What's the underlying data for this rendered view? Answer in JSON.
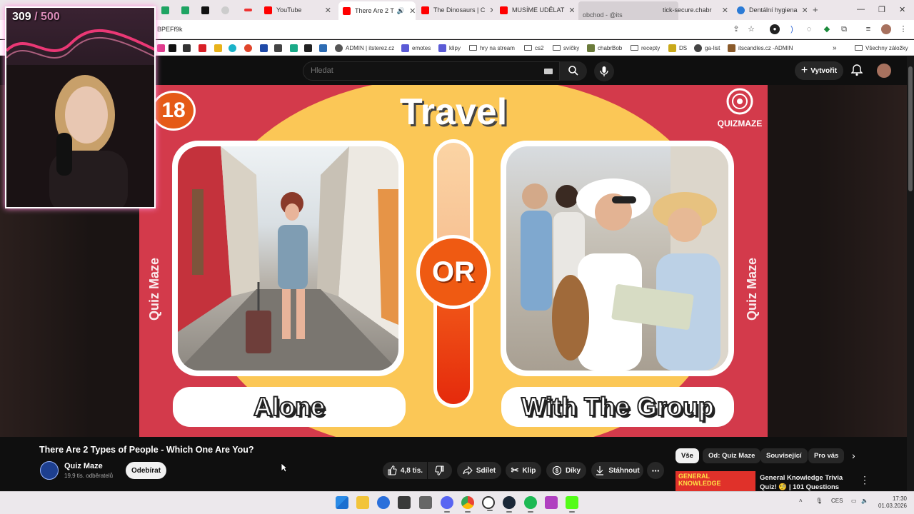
{
  "browser": {
    "tabs": [
      {
        "title": "YouTube",
        "favicon_color": "#ff0000"
      },
      {
        "title": "There Are 2 T",
        "favicon_color": "#ff0000",
        "active": true
      },
      {
        "title": "The Dinosaurs | C",
        "favicon_color": "#ff0000"
      },
      {
        "title": "MUSÍME UDĚLAT",
        "favicon_color": "#ff0000"
      },
      {
        "title": "obchod - @its",
        "favicon_color": "#888888"
      },
      {
        "title": "tick-secure.chabr",
        "favicon_color": "#555555"
      },
      {
        "title": "Dentální hygiena",
        "favicon_color": "#2b7bd6"
      }
    ],
    "url": "BPEFf9k",
    "bookmarks": [
      {
        "label": "ADMIN | itsterez.cz",
        "color": "#555555"
      },
      {
        "label": "emotes",
        "color": "#5b5bd6"
      },
      {
        "label": "klipy",
        "color": "#5b5bd6"
      },
      {
        "label": "hry na stream",
        "folder": true
      },
      {
        "label": "cs2",
        "folder": true
      },
      {
        "label": "svíčky",
        "folder": true
      },
      {
        "label": "chabrBob",
        "color": "#6b7b3b"
      },
      {
        "label": "recepty",
        "folder": true
      },
      {
        "label": "DS",
        "color": "#c9a91a"
      },
      {
        "label": "ga-list",
        "color": "#444444"
      },
      {
        "label": "itscandles.cz -ADMIN",
        "color": "#8a5a2a"
      }
    ],
    "all_bookmarks": "Všechny záložky"
  },
  "youtube": {
    "search_placeholder": "Hledat",
    "create_label": "Vytvořit"
  },
  "overlay": {
    "count": "309",
    "separator": " / ",
    "goal": "500"
  },
  "thumbnail": {
    "number": "18",
    "title": "Travel",
    "logo_text": "QUIZMAZE",
    "side_text": "Quiz Maze",
    "or_label": "OR",
    "option_left": "Alone",
    "option_right": "With The Group"
  },
  "video": {
    "title": "There Are 2 Types of People - Which One Are You?",
    "channel": "Quiz Maze",
    "subscribers": "19,9 tis. odběratelů",
    "subscribe_label": "Odebírat",
    "likes": "4,8 tis.",
    "share_label": "Sdílet",
    "clip_label": "Klip",
    "thanks_label": "Díky",
    "download_label": "Stáhnout"
  },
  "filter_chips": [
    "Vše",
    "Od: Quiz Maze",
    "Související",
    "Pro vás"
  ],
  "recommendation": {
    "thumb_text": "GENERAL KNOWLEDGE",
    "title": "General Knowledge Trivia Quiz! 🧐 | 101 Questions EVERYON..."
  },
  "taskbar": {
    "language": "CES",
    "time": "17:30",
    "date": "01.03.2026"
  },
  "colors": {
    "thumb_red": "#d33a4b",
    "thumb_yellow": "#fbc756",
    "or_orange": "#ef5a12",
    "yt_bg": "#0f0f0f"
  }
}
